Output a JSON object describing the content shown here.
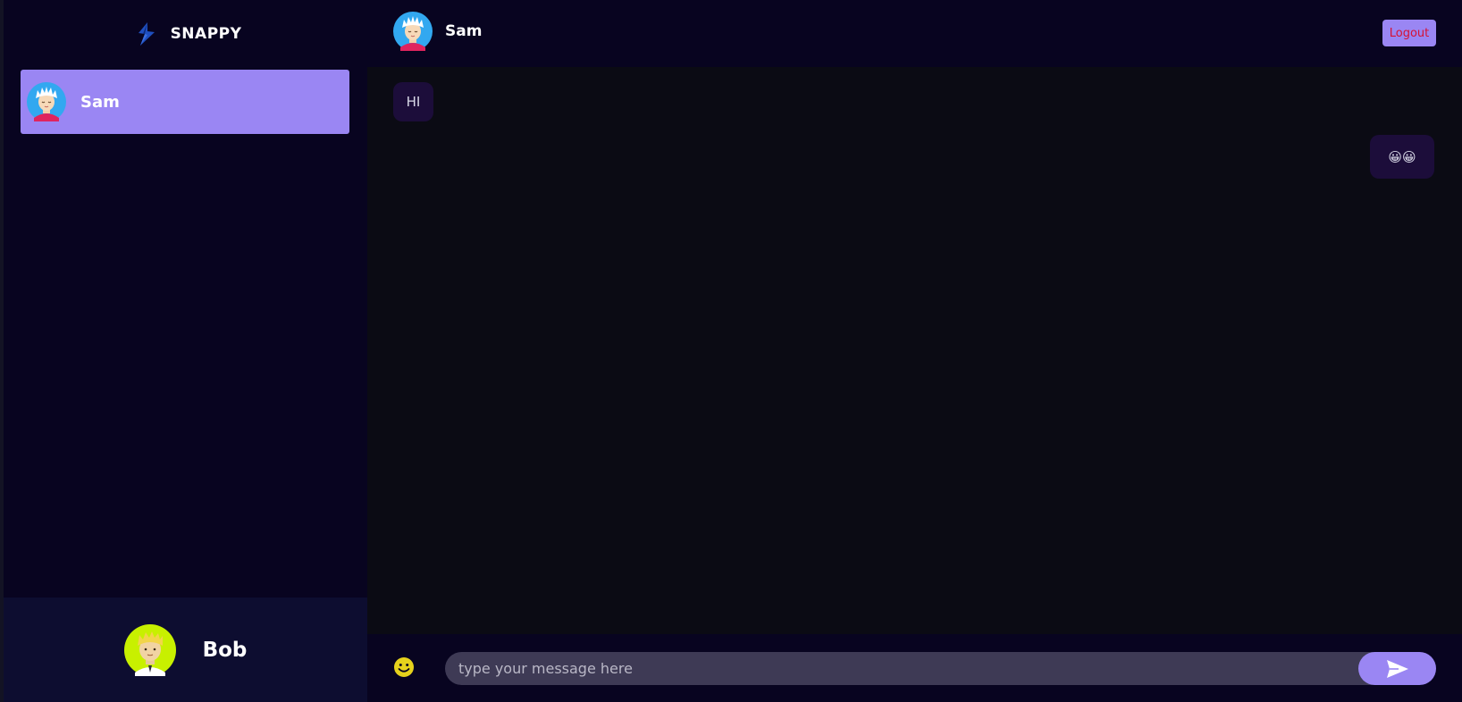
{
  "app": {
    "brand_name": "SNAPPY",
    "logo_icon": "snappy-logo-icon"
  },
  "contacts": [
    {
      "name": "Sam",
      "avatar": "sam-avatar-icon",
      "selected": true
    }
  ],
  "current_user": {
    "name": "Bob",
    "avatar": "bob-avatar-icon"
  },
  "chat": {
    "header": {
      "user_name": "Sam",
      "avatar": "sam-avatar-icon",
      "logout_label": "Logout"
    },
    "messages": [
      {
        "direction": "received",
        "text": "HI"
      },
      {
        "direction": "sent",
        "text": "😀😀"
      }
    ],
    "input": {
      "placeholder": "type your message here",
      "value": "",
      "emoji_icon": "emoji-picker-icon",
      "send_icon": "send-icon"
    }
  },
  "colors": {
    "background": "#0b0b14",
    "panel": "#080420",
    "accent": "#9a86f3",
    "bubble": "#1c0d3a",
    "logout_text": "#d61234",
    "input_bg": "#3e3a55",
    "current_user_bg": "#0d0d30"
  }
}
